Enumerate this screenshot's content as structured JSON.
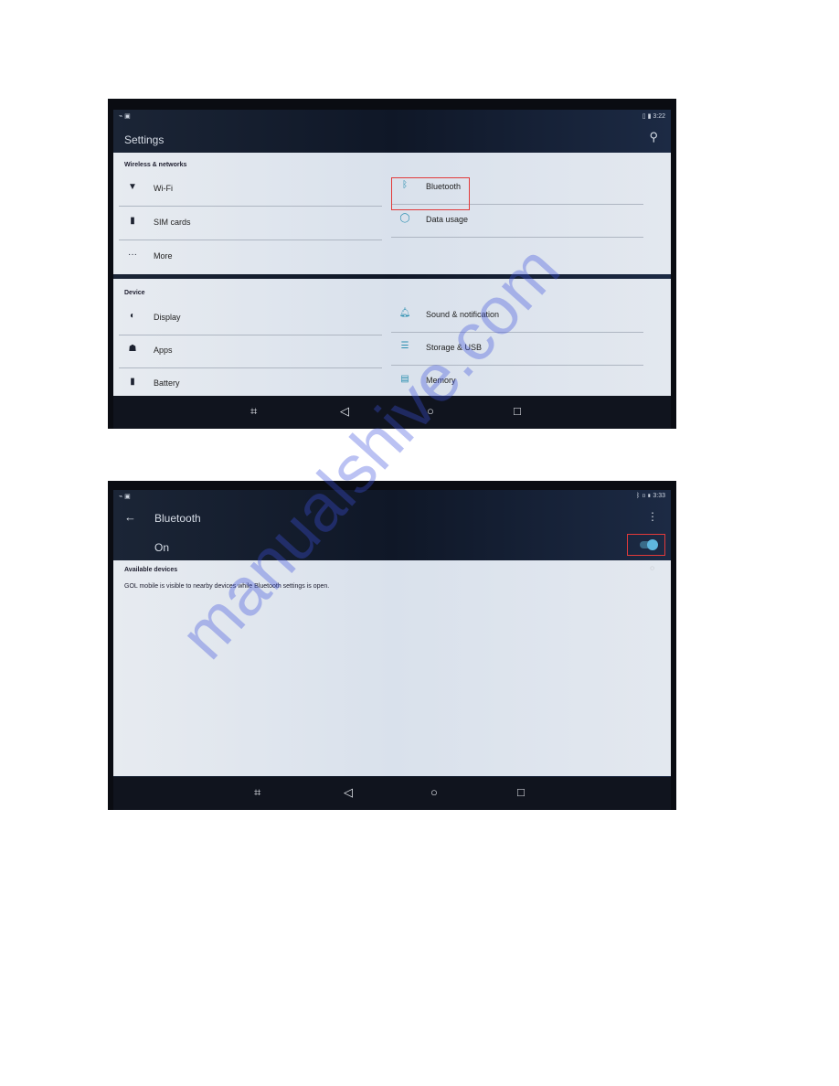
{
  "screen1": {
    "status_time": "3:22",
    "title": "Settings",
    "search_icon": "search-icon",
    "sections": [
      {
        "label": "Wireless & networks"
      },
      {
        "label": "Device"
      }
    ],
    "wireless_left": [
      {
        "label": "Wi-Fi",
        "icon": "wifi-icon"
      },
      {
        "label": "SIM cards",
        "icon": "sim-card-icon"
      },
      {
        "label": "More",
        "icon": "more-dots-icon"
      }
    ],
    "wireless_right": [
      {
        "label": "Bluetooth",
        "icon": "bluetooth-icon"
      },
      {
        "label": "Data usage",
        "icon": "data-usage-icon"
      }
    ],
    "device_left": [
      {
        "label": "Display",
        "icon": "brightness-icon"
      },
      {
        "label": "Apps",
        "icon": "android-icon"
      },
      {
        "label": "Battery",
        "icon": "battery-icon"
      }
    ],
    "device_right": [
      {
        "label": "Sound & notification",
        "icon": "bell-icon"
      },
      {
        "label": "Storage & USB",
        "icon": "storage-icon"
      },
      {
        "label": "Memory",
        "icon": "memory-icon"
      }
    ],
    "highlight": "Bluetooth"
  },
  "screen2": {
    "status_time": "3:33",
    "title": "Bluetooth",
    "switch_label": "On",
    "switch_state": true,
    "section": "Available devices",
    "message": "GOL mobile is visible to nearby devices while Bluetooth settings is open."
  },
  "colors": {
    "highlight": "#e23a3a",
    "accent": "#2c8fb0"
  },
  "watermark": "manualshive.com"
}
